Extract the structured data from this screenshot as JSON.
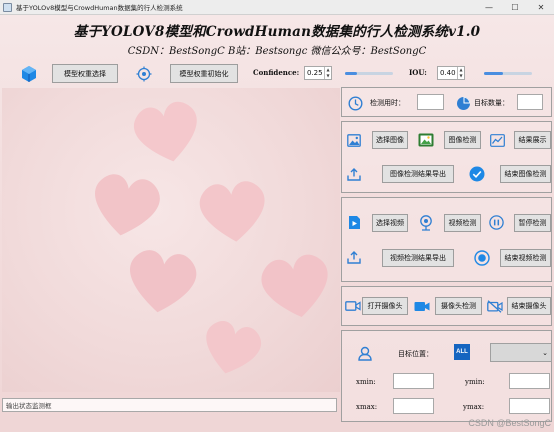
{
  "window": {
    "title": "基于YOLOv8模型与CrowdHuman数据集的行人检测系统",
    "controls": {
      "minimize": "—",
      "maximize": "☐",
      "close": "✕"
    }
  },
  "header": {
    "title": "基于YOLOV8模型和CrowdHuman数据集的行人检测系统v1.0",
    "subtitle": "CSDN：BestSongC   B站：Bestsongc   微信公众号：BestSongC"
  },
  "toolbar": {
    "select_weights": "模型权重选择",
    "init_weights": "模型权重初始化",
    "confidence_label": "Confidence:",
    "confidence_value": "0.25",
    "confidence_level": 0.25,
    "iou_label": "IOU:",
    "iou_value": "0.40",
    "iou_level": 0.4
  },
  "status_bar": {
    "placeholder": "输出状态监测框"
  },
  "stats": {
    "time_label": "检测用时：",
    "count_label": "目标数量："
  },
  "image_group": {
    "select": "选择图像",
    "detect": "图像检测",
    "show": "结果展示",
    "export": "图像检测结果导出",
    "end": "结束图像检测"
  },
  "video_group": {
    "select": "选择视频",
    "detect": "视频检测",
    "pause": "暂停检测",
    "export": "视频检测结果导出",
    "end": "结束视频检测"
  },
  "camera_group": {
    "open": "打开摄像头",
    "detect": "摄像头检测",
    "end": "结束摄像头"
  },
  "target_group": {
    "position_label": "目标位置：",
    "all_label": "ALL",
    "xmin": "xmin:",
    "ymin": "ymin:",
    "xmax": "xmax:",
    "ymax": "ymax:"
  },
  "watermark": "CSDN @BestSongC",
  "colors": {
    "accent": "#2f7fd3",
    "background": "#f1dddd",
    "heart": "#f4c8cc"
  }
}
